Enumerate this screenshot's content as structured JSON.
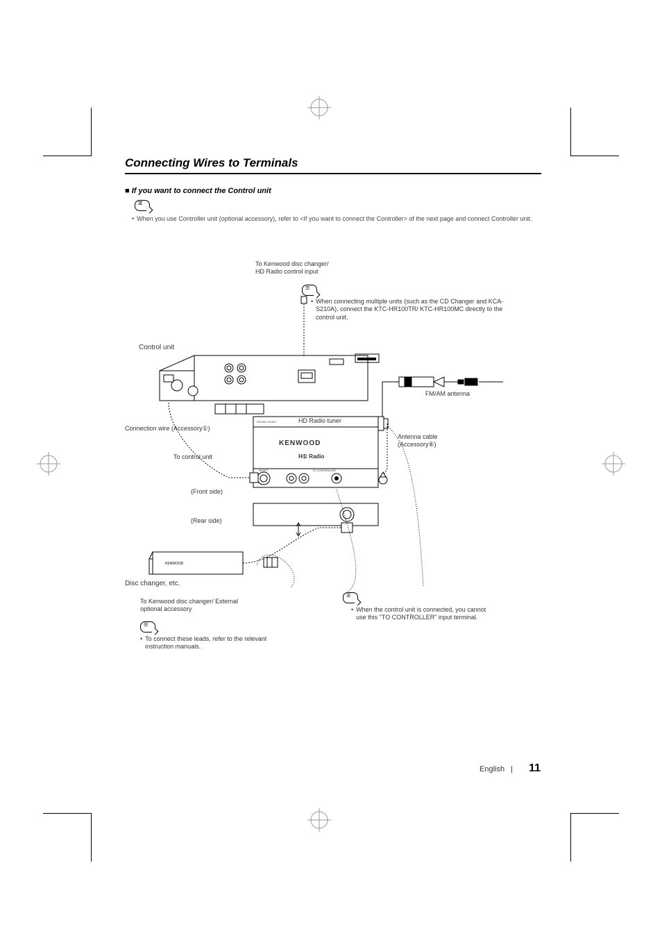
{
  "title": "Connecting Wires to Terminals",
  "subtitle": "■ If you want to connect the Control unit",
  "top_note": "When you use Controller unit (optional accessory), refer to <If you want to connect the Controller> of the next page and connect Controller unit.",
  "diagram": {
    "top_label": "To Kenwood disc changer/\nHD Radio control input",
    "multi_note": "When connecting multiple units (such as the CD Changer and KCA-S210A), connect the KTC-HR100TR/ KTC-HR100MC directly to the control unit.",
    "control_unit": "Control unit",
    "conn_wire": "Connection wire (Accessory①)",
    "to_control": "To control unit",
    "front": "(Front side)",
    "rear": "(Rear side)",
    "hd_tuner": "HD Radio tuner",
    "fm_am": "FM/AM antenna",
    "ant_cable": "Antenna cable\n(Accessory⑥)",
    "disc_changer": "Disc changer, etc.",
    "ext_opt": "To Kenwood disc changer/ External optional accessory",
    "manuals_note": "To connect these leads, refer to the relevant instruction manuals.",
    "controller_note": "When the control unit is connected, you cannot use this \"TO CONTROLLER\" input terminal.",
    "kenwood": "KENWOOD",
    "hd_radio": "H① Radio",
    "tuner_tiny_top": "FM ANT IN  ANT",
    "tuner_tiny_bot1": "RESET",
    "tuner_tiny_bot2": "TO CONTROLLER",
    "bot_tiny": "——"
  },
  "footer_lang": "English",
  "footer_page": "11"
}
